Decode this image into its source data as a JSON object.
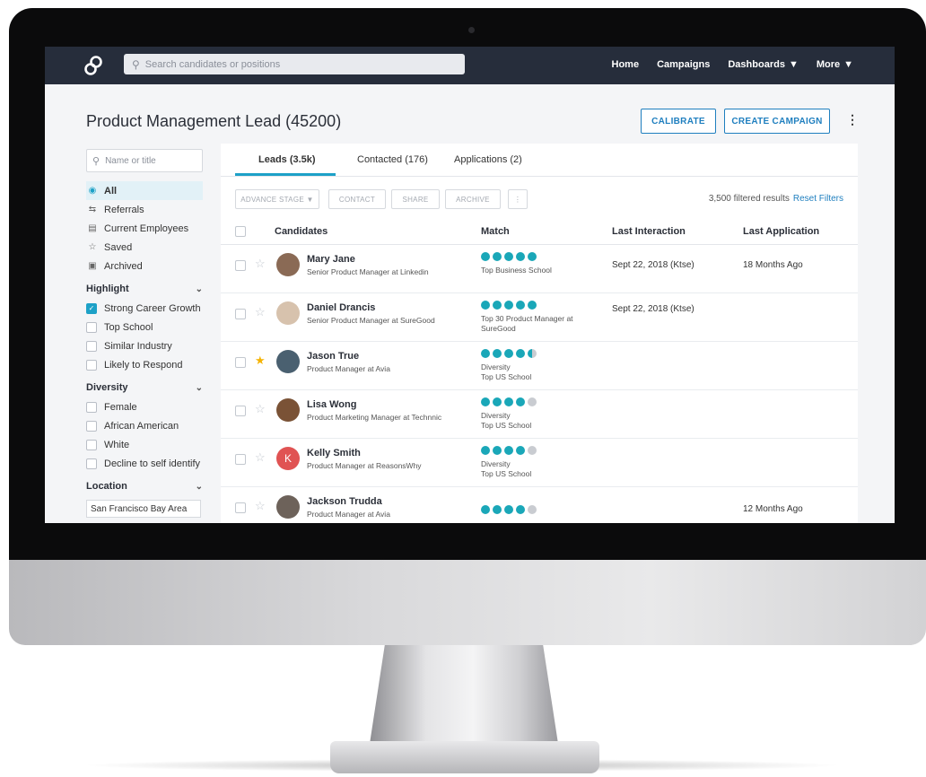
{
  "nav": {
    "search_placeholder": "Search candidates or positions",
    "links": [
      "Home",
      "Campaigns",
      "Dashboards",
      "More"
    ]
  },
  "page": {
    "title": "Product Management Lead (45200)",
    "calibrate": "CALIBRATE",
    "create_campaign": "CREATE CAMPAIGN"
  },
  "sidebar": {
    "filter_placeholder": "Name or title",
    "views": [
      {
        "label": "All",
        "icon": "shield-icon"
      },
      {
        "label": "Referrals",
        "icon": "referral-icon"
      },
      {
        "label": "Current Employees",
        "icon": "id-card-icon"
      },
      {
        "label": "Saved",
        "icon": "star-icon"
      },
      {
        "label": "Archived",
        "icon": "archive-icon"
      }
    ],
    "highlight_title": "Highlight",
    "highlight": [
      "Strong Career Growth",
      "Top School",
      "Similar Industry",
      "Likely to Respond"
    ],
    "diversity_title": "Diversity",
    "diversity": [
      "Female",
      "African American",
      "White",
      "Decline to self identify"
    ],
    "location_title": "Location",
    "location_value": "San Francisco Bay Area"
  },
  "tabs": [
    "Leads (3.5k)",
    "Contacted (176)",
    "Applications (2)"
  ],
  "actions": [
    "ADVANCE STAGE",
    "CONTACT",
    "SHARE",
    "ARCHIVE"
  ],
  "results": {
    "count": "3,500 filtered results",
    "reset": "Reset Filters"
  },
  "columns": [
    "Candidates",
    "Match",
    "Last Interaction",
    "Last Application"
  ],
  "candidates": [
    {
      "name": "Mary Jane",
      "title": "Senior Product Manager at Linkedin",
      "score": 5,
      "match_text": "Top Business School",
      "last_interaction": "Sept 22, 2018 (Ktse)",
      "last_application": "18 Months Ago",
      "starred": false,
      "avatar_color": "#8a6a55",
      "initial": ""
    },
    {
      "name": "Daniel Drancis",
      "title": "Senior Product Manager at SureGood",
      "score": 5,
      "match_text": "Top 30 Product Manager at SureGood",
      "last_interaction": "Sept 22, 2018 (Ktse)",
      "last_application": "",
      "starred": false,
      "avatar_color": "#d7c2ad",
      "initial": ""
    },
    {
      "name": "Jason True",
      "title": "Product Manager at Avia",
      "score": 4.5,
      "match_text": "Diversity\nTop US School",
      "last_interaction": "",
      "last_application": "",
      "starred": true,
      "avatar_color": "#4a6070",
      "initial": ""
    },
    {
      "name": "Lisa Wong",
      "title": "Product Marketing Manager at Technnic",
      "score": 4,
      "match_text": "Diversity\nTop US School",
      "last_interaction": "",
      "last_application": "",
      "starred": false,
      "avatar_color": "#7a5236",
      "initial": ""
    },
    {
      "name": "Kelly Smith",
      "title": "Product Manager at ReasonsWhy",
      "score": 4,
      "match_text": "Diversity\nTop US School",
      "last_interaction": "",
      "last_application": "",
      "starred": false,
      "avatar_color": "#e05353",
      "initial": "K"
    },
    {
      "name": "Jackson Trudda",
      "title": "Product Manager at Avia",
      "score": 4,
      "match_text": "",
      "last_interaction": "",
      "last_application": "12 Months Ago",
      "starred": false,
      "avatar_color": "#6d625a",
      "initial": ""
    }
  ]
}
